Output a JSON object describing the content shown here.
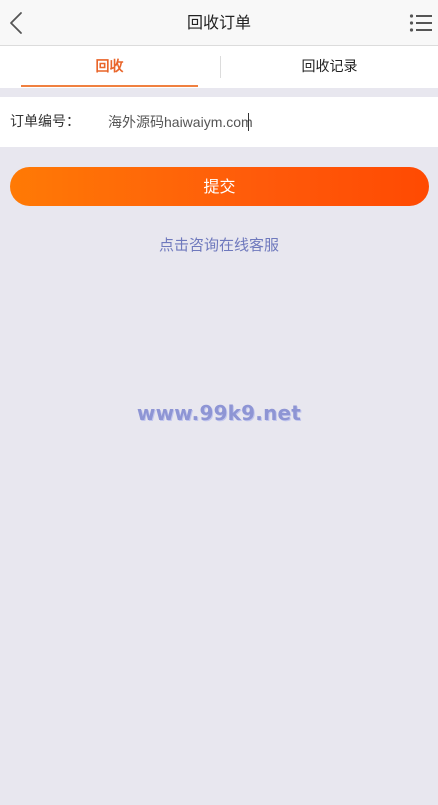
{
  "header": {
    "title": "回收订单",
    "back_icon": "chevron-left-icon",
    "menu_icon": "list-menu-icon"
  },
  "tabs": [
    {
      "label": "回收",
      "active": true
    },
    {
      "label": "回收记录",
      "active": false
    }
  ],
  "form": {
    "order_label": "订单编号：",
    "order_value": "海外源码haiwaiym.com"
  },
  "submit": {
    "label": "提交"
  },
  "consult": {
    "label": "点击咨询在线客服"
  },
  "watermark": {
    "text": "www.99k9.net"
  },
  "colors": {
    "accent": "#e9652a",
    "button_start": "#ff7a05",
    "button_end": "#ff4a02",
    "link": "#6f79bd",
    "background": "#e8e7ef"
  }
}
